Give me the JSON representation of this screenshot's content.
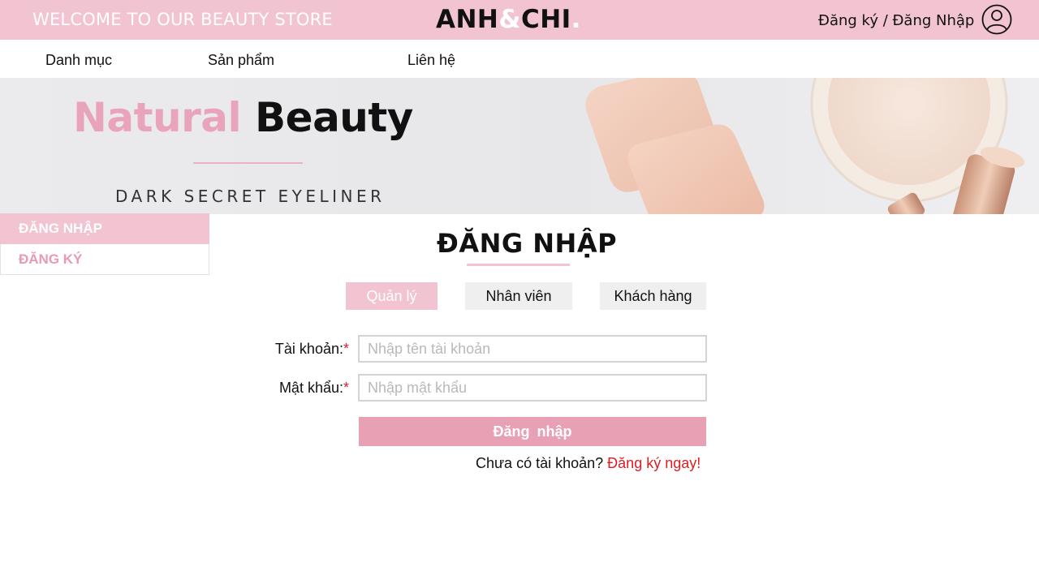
{
  "header": {
    "welcome": "WELCOME TO OUR BEAUTY STORE",
    "logo_part1": "ANH",
    "logo_amp": "&",
    "logo_part2": "CHI",
    "logo_dot": ".",
    "auth_link": "Đăng ký / Đăng Nhập",
    "user_icon": "user-circle-icon"
  },
  "nav": {
    "items": [
      {
        "label": "Danh mục"
      },
      {
        "label": "Sản phẩm"
      },
      {
        "label": "Liên hệ"
      }
    ]
  },
  "banner": {
    "title_word1": "Natural",
    "title_word2": "Beauty",
    "subtitle": "DARK SECRET EYELINER"
  },
  "sidebar": {
    "items": [
      {
        "label": "ĐĂNG NHẬP",
        "active": true
      },
      {
        "label": "ĐĂNG KÝ",
        "active": false
      }
    ]
  },
  "login": {
    "title": "ĐĂNG NHẬP",
    "roles": [
      {
        "label": "Quản lý",
        "active": true
      },
      {
        "label": "Nhân viên",
        "active": false
      },
      {
        "label": "Khách hàng",
        "active": false
      }
    ],
    "username_label": "Tài khoản:",
    "username_placeholder": "Nhập tên tài khoản",
    "password_label": "Mật khẩu:",
    "password_placeholder": "Nhập mật khẩu",
    "required_mark": "*",
    "submit_label": "Đăng nhập",
    "no_account_text": "Chưa có tài khoản?",
    "signup_link": "Đăng ký ngay!"
  },
  "colors": {
    "brand_pink": "#f2c4d2",
    "button_pink": "#e8a0b4",
    "accent_red": "#e01b22"
  }
}
